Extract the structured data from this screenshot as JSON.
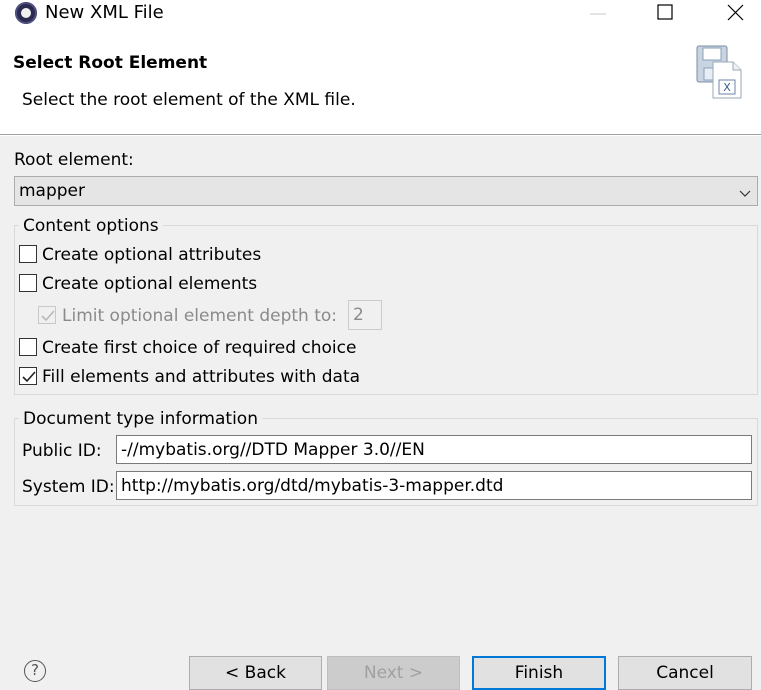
{
  "window": {
    "title": "New XML File",
    "controls": [
      "minimize",
      "maximize",
      "close"
    ]
  },
  "banner": {
    "title": "Select Root Element",
    "description": "Select the root element of the XML file.",
    "icon": "xml-file-wizard-icon"
  },
  "root_element": {
    "label": "Root element:",
    "selected": "mapper"
  },
  "content_options": {
    "legend": "Content options",
    "create_optional_attributes": {
      "label": "Create optional attributes",
      "checked": false
    },
    "create_optional_elements": {
      "label": "Create optional elements",
      "checked": false
    },
    "limit_depth": {
      "label": "Limit optional element depth to:",
      "checked": true,
      "enabled": false,
      "value": "2"
    },
    "create_first_choice": {
      "label": "Create first choice of required choice",
      "checked": false
    },
    "fill_elements": {
      "label": "Fill elements and attributes with data",
      "checked": true
    }
  },
  "doc_type": {
    "legend": "Document type information",
    "public_id_label": "Public ID:",
    "public_id_value": "-//mybatis.org//DTD Mapper 3.0//EN",
    "system_id_label": "System ID:",
    "system_id_value": "http://mybatis.org/dtd/mybatis-3-mapper.dtd"
  },
  "buttons": {
    "help": "?",
    "back": "< Back",
    "next": "Next >",
    "finish": "Finish",
    "cancel": "Cancel"
  }
}
